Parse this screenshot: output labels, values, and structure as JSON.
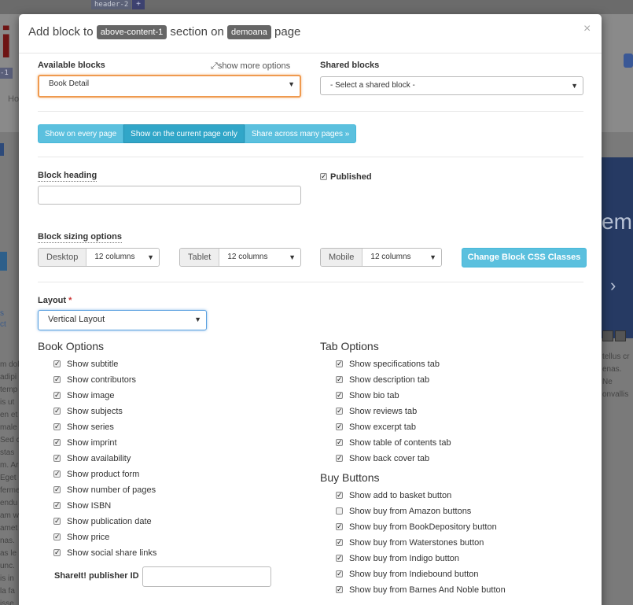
{
  "background": {
    "header_tag": "header-2",
    "plus": "+",
    "left_tag": "-1",
    "nav_text": "Ho",
    "slider_text": "em",
    "arrow": "›",
    "right_text": [
      "tellus cr",
      "enas. Ne",
      "onvallis"
    ],
    "left_links": [
      "s",
      "ct"
    ],
    "left_text": [
      "m dolo",
      "adipi",
      "temp",
      "is ut",
      "en et",
      "male",
      "Sed c",
      "stas",
      "m. Ar",
      "Eget",
      "ferme",
      "endu",
      "am w",
      "amet",
      "nas.",
      "as le",
      "unc.",
      "is in",
      "la fa",
      "isse"
    ]
  },
  "modal": {
    "title": {
      "prefix": "Add block to",
      "section_tag": "above-content-1",
      "middle": "section on",
      "page_tag": "demoana",
      "suffix": "page"
    },
    "close": "×",
    "available_blocks": {
      "label": "Available blocks",
      "show_more": "show more options",
      "value": "Book Detail"
    },
    "shared_blocks": {
      "label": "Shared blocks",
      "value": "- Select a shared block -"
    },
    "visibility_buttons": [
      "Show on every page",
      "Show on the current page only",
      "Share across many pages »"
    ],
    "block_heading": {
      "label": "Block heading",
      "value": ""
    },
    "published": {
      "label": "Published",
      "checked": true
    },
    "sizing": {
      "label": "Block sizing options",
      "desktop": {
        "label": "Desktop",
        "value": "12 columns"
      },
      "tablet": {
        "label": "Tablet",
        "value": "12 columns"
      },
      "mobile": {
        "label": "Mobile",
        "value": "12 columns"
      },
      "css_button": "Change Block CSS Classes"
    },
    "layout": {
      "label": "Layout",
      "required": "*",
      "value": "Vertical Layout"
    },
    "book_options": {
      "heading": "Book Options",
      "items": [
        {
          "label": "Show subtitle",
          "checked": true
        },
        {
          "label": "Show contributors",
          "checked": true
        },
        {
          "label": "Show image",
          "checked": true
        },
        {
          "label": "Show subjects",
          "checked": true
        },
        {
          "label": "Show series",
          "checked": true
        },
        {
          "label": "Show imprint",
          "checked": true
        },
        {
          "label": "Show availability",
          "checked": true
        },
        {
          "label": "Show product form",
          "checked": true
        },
        {
          "label": "Show number of pages",
          "checked": true
        },
        {
          "label": "Show ISBN",
          "checked": true
        },
        {
          "label": "Show publication date",
          "checked": true
        },
        {
          "label": "Show price",
          "checked": true
        },
        {
          "label": "Show social share links",
          "checked": true
        }
      ]
    },
    "shareit": {
      "label": "ShareIt! publisher ID",
      "value": ""
    },
    "tab_options": {
      "heading": "Tab Options",
      "items": [
        {
          "label": "Show specifications tab",
          "checked": true
        },
        {
          "label": "Show description tab",
          "checked": true
        },
        {
          "label": "Show bio tab",
          "checked": true
        },
        {
          "label": "Show reviews tab",
          "checked": true
        },
        {
          "label": "Show excerpt tab",
          "checked": true
        },
        {
          "label": "Show table of contents tab",
          "checked": true
        },
        {
          "label": "Show back cover tab",
          "checked": true
        }
      ]
    },
    "buy_buttons": {
      "heading": "Buy Buttons",
      "items": [
        {
          "label": "Show add to basket button",
          "checked": true
        },
        {
          "label": "Show buy from Amazon buttons",
          "checked": false
        },
        {
          "label": "Show buy from BookDepository button",
          "checked": true
        },
        {
          "label": "Show buy from Waterstones button",
          "checked": true
        },
        {
          "label": "Show buy from Indigo button",
          "checked": true
        },
        {
          "label": "Show buy from Indiebound button",
          "checked": true
        },
        {
          "label": "Show buy from Barnes And Noble button",
          "checked": true
        }
      ]
    }
  }
}
